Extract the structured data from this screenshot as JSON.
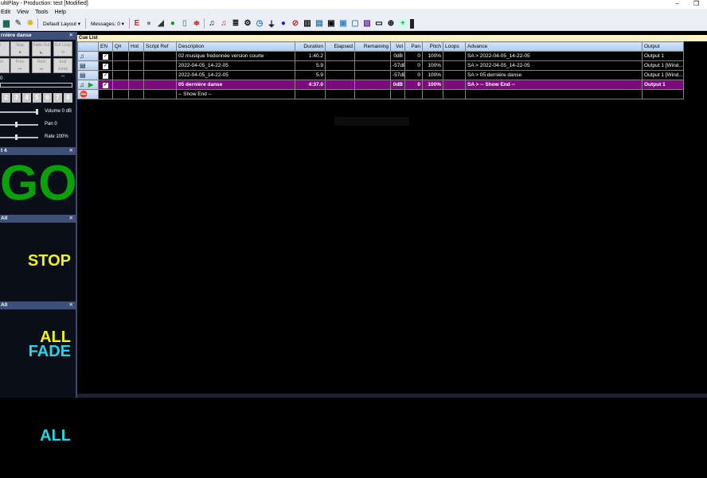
{
  "window": {
    "title": "ultiPlay - Production: test [Modified]",
    "minimize": "–",
    "restore": "❐"
  },
  "menu": [
    "Edit",
    "View",
    "Tools",
    "Help"
  ],
  "toolbar": {
    "layout": "Default Layout",
    "messages": "Messages: 0"
  },
  "cue_panel": {
    "title": "rnière danse",
    "close": "✕",
    "buttons": [
      "Stop",
      "Fade Out",
      "Ext Loop",
      "Start",
      "Prev",
      "Next",
      "End Jump"
    ],
    "partial_buttons": [
      "e",
      "tart"
    ],
    "position": "0",
    "numbers": [
      "2",
      "3",
      "4",
      "5",
      "6",
      "7",
      "8"
    ],
    "volume": "Volume 0 dB",
    "pan": "Pan 0",
    "rate": "Rate 100%",
    "volume_level": 1.0,
    "pan_level": 0.5,
    "rate_level": 0.5
  },
  "go_panel": {
    "title": "t 4",
    "label": "GO",
    "color": "#0aa00a"
  },
  "stop_panel": {
    "title": "All",
    "label": "STOP ALL",
    "color": "#f3f316"
  },
  "fade_panel": {
    "title": "All",
    "label": "FADE ALL",
    "color": "#22d8e8"
  },
  "cue_list": {
    "title": "Cue List",
    "columns": [
      "",
      "EN",
      "Q#",
      "Hot",
      "Script Ref",
      "Description",
      "Duration",
      "Elapsed",
      "Remaining",
      "Vol",
      "Pan",
      "Pitch",
      "Loops",
      "Advance",
      "Output"
    ],
    "rows": [
      {
        "icon": "♫",
        "en": "✓",
        "desc": "02 musique fredonnée version courte",
        "duration": "1:40.2",
        "vol": "0dB",
        "pan": "0",
        "pitch": "100%",
        "advance": "SA > 2022-04-05_14-22-05",
        "output": "Output 1"
      },
      {
        "icon": "▤",
        "en": "✓",
        "desc": "2022-04-05_14-22-05",
        "duration": "5.9",
        "vol": "-57dB",
        "pan": "0",
        "pitch": "100%",
        "advance": "SA > 2022-04-05_14-22-05",
        "output": "Output 1 [Wind..."
      },
      {
        "icon": "▤",
        "en": "✓",
        "desc": "2022-04-05_14-22-05",
        "duration": "5.9",
        "vol": "-57dB",
        "pan": "0",
        "pitch": "100%",
        "advance": "SA > 05 dernière danse",
        "output": "Output 1 [Wind..."
      },
      {
        "icon": "♫",
        "play": "▶",
        "en": "✓",
        "desc": "05 dernière danse",
        "duration": "4:37.0",
        "vol": "0dB",
        "pan": "0",
        "pitch": "100%",
        "advance": "SA > -- Show End --",
        "output": "Output 1"
      },
      {
        "icon": "⛔",
        "desc": "-- Show End --"
      }
    ]
  }
}
